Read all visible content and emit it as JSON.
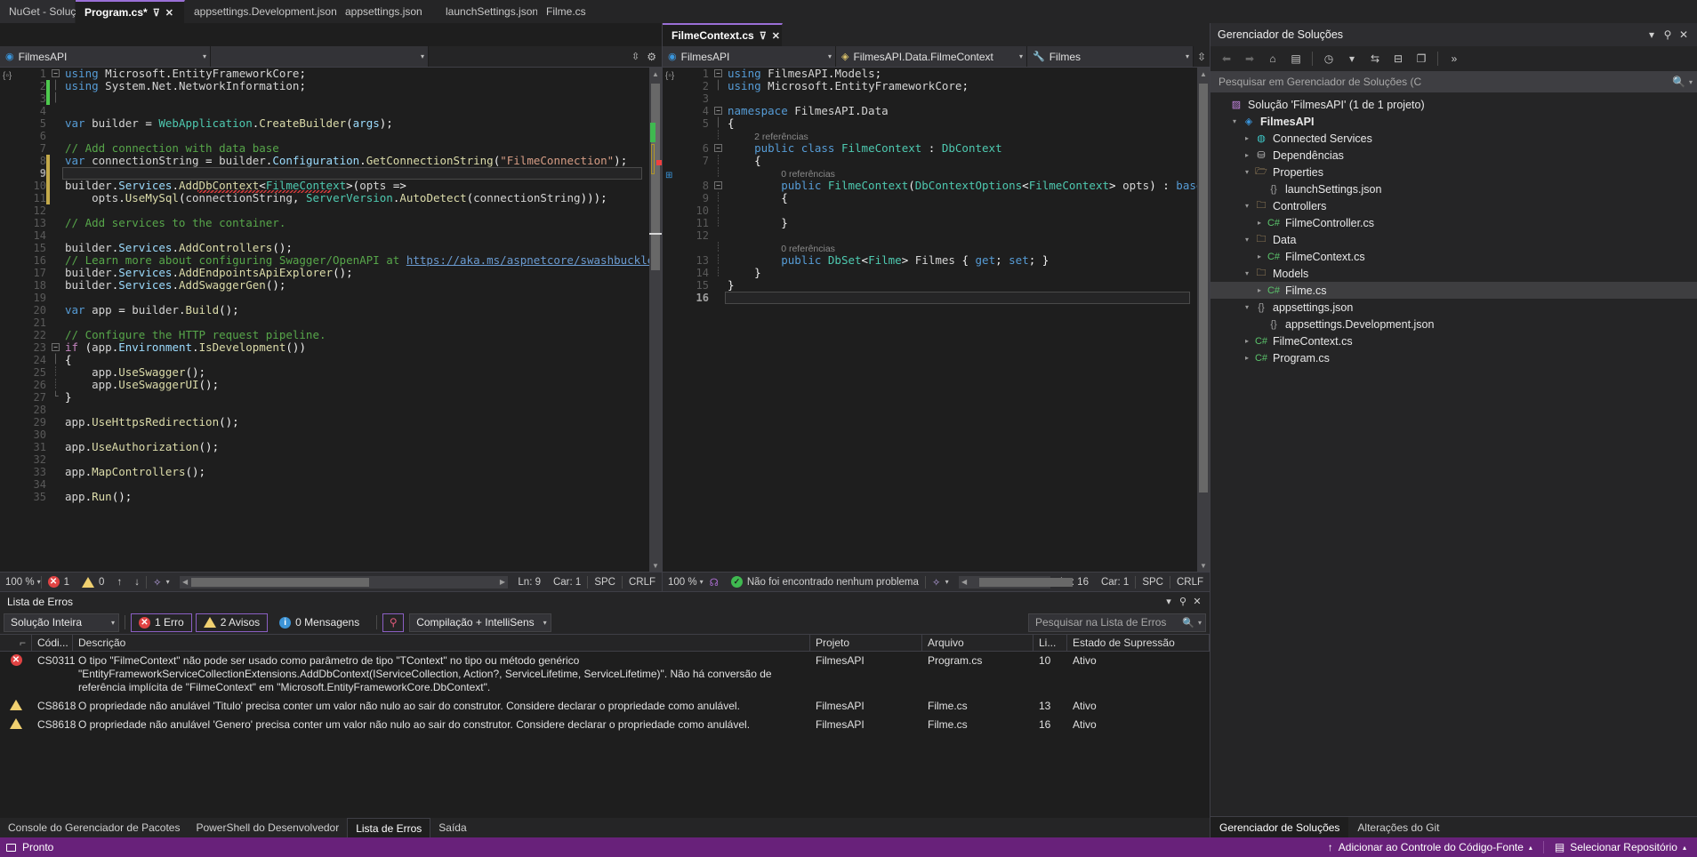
{
  "top_tabs": [
    {
      "label": "NuGet - Solução",
      "state": "inactive",
      "kind": "tool"
    },
    {
      "label": "Program.cs*",
      "state": "active",
      "kind": "doc",
      "pin": "⊽",
      "close": "✕"
    },
    {
      "label": "appsettings.Development.json",
      "state": "inactive",
      "kind": "doc"
    },
    {
      "label": "appsettings.json",
      "state": "inactive",
      "kind": "doc"
    },
    {
      "label": "launchSettings.json",
      "state": "inactive",
      "kind": "doc"
    },
    {
      "label": "Filme.cs",
      "state": "inactive",
      "kind": "doc"
    }
  ],
  "left_pane": {
    "tab": {
      "label": "Filme.cs",
      "menu_icon": "▼",
      "settings_icon": "⚙"
    },
    "nav_left": {
      "label": "FilmesAPI",
      "icon": "globe-icon",
      "caret": "▾"
    },
    "nav_right": {
      "label": "",
      "caret": "▾"
    },
    "status": {
      "zoom": "100 %",
      "error_count": "1",
      "warning_count": "0",
      "up_arrow": "↑",
      "down_arrow": "↓",
      "line": "Ln: 9",
      "col": "Car: 1",
      "spaces": "SPC",
      "eol": "CRLF"
    },
    "code": [
      {
        "n": "1",
        "fold": "minus",
        "chg": "",
        "html": "<span class=\"kw\">using</span> <span class=\"ns\">Microsoft</span>.<span class=\"ns\">EntityFrameworkCore</span>;"
      },
      {
        "n": "2",
        "fold": "bar",
        "chg": "green",
        "html": "<span class=\"kw\">using</span> <span class=\"ns\">System</span>.<span class=\"ns\">Net</span>.<span class=\"ns\">NetworkInformation</span>;"
      },
      {
        "n": "3",
        "fold": "bar",
        "chg": "green",
        "html": ""
      },
      {
        "n": "4",
        "fold": "",
        "chg": "",
        "html": ""
      },
      {
        "n": "5",
        "fold": "",
        "chg": "",
        "html": "<span class=\"kw\">var</span> <span class=\"id\">builder</span> = <span class=\"typ\">WebApplication</span>.<span class=\"fn\">CreateBuilder</span>(<span class=\"var\">args</span>);"
      },
      {
        "n": "6",
        "fold": "",
        "chg": "",
        "html": ""
      },
      {
        "n": "7",
        "fold": "",
        "chg": "",
        "html": "<span class=\"cmt\">// Add connection with data base</span>"
      },
      {
        "n": "8",
        "fold": "",
        "chg": "yellow",
        "html": "<span class=\"kw\">var</span> <span class=\"id\">connectionString</span> = <span class=\"id\">builder</span>.<span class=\"var\">Configuration</span>.<span class=\"fn\">GetConnectionString</span>(<span class=\"str\">\"FilmeConnection\"</span>);"
      },
      {
        "n": "9",
        "fold": "",
        "chg": "yellow",
        "html": "",
        "current": true,
        "pencil": true
      },
      {
        "n": "10",
        "fold": "",
        "chg": "yellow",
        "html": "<span class=\"id\">builder</span>.<span class=\"var\">Services</span>.<span class=\"fn\">AddDbContext</span>&lt;<span class=\"typ\">FilmeContext</span>&gt;(<span class=\"id\">opts</span> =&gt;",
        "error_squiggle": true
      },
      {
        "n": "11",
        "fold": "",
        "chg": "yellow",
        "html": "    <span class=\"id\">opts</span>.<span class=\"fn\">UseMySql</span>(<span class=\"id\">connectionString</span>, <span class=\"typ\">ServerVersion</span>.<span class=\"fn\">AutoDetect</span>(<span class=\"id\">connectionString</span>)));"
      },
      {
        "n": "12",
        "fold": "",
        "chg": "",
        "html": ""
      },
      {
        "n": "13",
        "fold": "",
        "chg": "",
        "html": "<span class=\"cmt\">// Add services to the container.</span>"
      },
      {
        "n": "14",
        "fold": "",
        "chg": "",
        "html": ""
      },
      {
        "n": "15",
        "fold": "",
        "chg": "",
        "html": "<span class=\"id\">builder</span>.<span class=\"var\">Services</span>.<span class=\"fn\">AddControllers</span>();"
      },
      {
        "n": "16",
        "fold": "",
        "chg": "",
        "html": "<span class=\"cmt\">// Learn more about configuring Swagger/OpenAPI at </span><span class=\"lnk\">https://aka.ms/aspnetcore/swashbuckle</span>"
      },
      {
        "n": "17",
        "fold": "",
        "chg": "",
        "html": "<span class=\"id\">builder</span>.<span class=\"var\">Services</span>.<span class=\"fn\">AddEndpointsApiExplorer</span>();"
      },
      {
        "n": "18",
        "fold": "",
        "chg": "",
        "html": "<span class=\"id\">builder</span>.<span class=\"var\">Services</span>.<span class=\"fn\">AddSwaggerGen</span>();"
      },
      {
        "n": "19",
        "fold": "",
        "chg": "",
        "html": ""
      },
      {
        "n": "20",
        "fold": "",
        "chg": "",
        "html": "<span class=\"kw\">var</span> <span class=\"id\">app</span> = <span class=\"id\">builder</span>.<span class=\"fn\">Build</span>();"
      },
      {
        "n": "21",
        "fold": "",
        "chg": "",
        "html": ""
      },
      {
        "n": "22",
        "fold": "",
        "chg": "",
        "html": "<span class=\"cmt\">// Configure the HTTP request pipeline.</span>"
      },
      {
        "n": "23",
        "fold": "minus",
        "chg": "",
        "html": "<span class=\"kwc\">if</span> (<span class=\"id\">app</span>.<span class=\"var\">Environment</span>.<span class=\"fn\">IsDevelopment</span>())"
      },
      {
        "n": "24",
        "fold": "bar",
        "chg": "",
        "html": "{"
      },
      {
        "n": "25",
        "fold": "dot",
        "chg": "",
        "html": "    <span class=\"id\">app</span>.<span class=\"fn\">UseSwagger</span>();"
      },
      {
        "n": "26",
        "fold": "dot",
        "chg": "",
        "html": "    <span class=\"id\">app</span>.<span class=\"fn\">UseSwaggerUI</span>();"
      },
      {
        "n": "27",
        "fold": "end",
        "chg": "",
        "html": "}"
      },
      {
        "n": "28",
        "fold": "",
        "chg": "",
        "html": ""
      },
      {
        "n": "29",
        "fold": "",
        "chg": "",
        "html": "<span class=\"id\">app</span>.<span class=\"fn\">UseHttpsRedirection</span>();"
      },
      {
        "n": "30",
        "fold": "",
        "chg": "",
        "html": ""
      },
      {
        "n": "31",
        "fold": "",
        "chg": "",
        "html": "<span class=\"id\">app</span>.<span class=\"fn\">UseAuthorization</span>();"
      },
      {
        "n": "32",
        "fold": "",
        "chg": "",
        "html": ""
      },
      {
        "n": "33",
        "fold": "",
        "chg": "",
        "html": "<span class=\"id\">app</span>.<span class=\"fn\">MapControllers</span>();"
      },
      {
        "n": "34",
        "fold": "",
        "chg": "",
        "html": ""
      },
      {
        "n": "35",
        "fold": "",
        "chg": "",
        "html": "<span class=\"id\">app</span>.<span class=\"fn\">Run</span>();"
      }
    ]
  },
  "right_pane": {
    "tab": {
      "label": "FilmeContext.cs",
      "pin": "⊽",
      "close": "✕"
    },
    "nav_left": {
      "label": "FilmesAPI",
      "icon": "globe-icon",
      "caret": "▾"
    },
    "nav_mid": {
      "label": "FilmesAPI.Data.FilmeContext",
      "icon": "class-icon",
      "caret": "▾"
    },
    "nav_right": {
      "label": "Filmes",
      "icon": "wrench-icon",
      "caret": "▾"
    },
    "status": {
      "zoom": "100 %",
      "message": "Não foi encontrado nenhum problema",
      "line": "Ln: 16",
      "col": "Car: 1",
      "spaces": "SPC",
      "eol": "CRLF"
    },
    "code": [
      {
        "n": "1",
        "fold": "minus",
        "html": "<span class=\"kw\">using</span> <span class=\"ns\">FilmesAPI</span>.<span class=\"ns\">Models</span>;"
      },
      {
        "n": "2",
        "fold": "bar",
        "html": "<span class=\"kw\">using</span> <span class=\"ns\">Microsoft</span>.<span class=\"ns\">EntityFrameworkCore</span>;"
      },
      {
        "n": "3",
        "fold": "",
        "html": ""
      },
      {
        "n": "4",
        "fold": "minus",
        "html": "<span class=\"kw\">namespace</span> <span class=\"ns\">FilmesAPI</span>.<span class=\"ns\">Data</span>"
      },
      {
        "n": "5",
        "fold": "bar",
        "html": "{"
      },
      {
        "n": "",
        "fold": "dot",
        "html": "    <span class=\"refs\">2 referências</span>",
        "isref": true
      },
      {
        "n": "6",
        "fold": "minus2",
        "html": "    <span class=\"kw\">public</span> <span class=\"kw\">class</span> <span class=\"typ\">FilmeContext</span> : <span class=\"typ\">DbContext</span>",
        "glyph": "io"
      },
      {
        "n": "7",
        "fold": "dot",
        "html": "    {"
      },
      {
        "n": "",
        "fold": "dot",
        "html": "        <span class=\"refs\">0 referências</span>",
        "isref": true
      },
      {
        "n": "8",
        "fold": "minus2",
        "html": "        <span class=\"kw\">public</span> <span class=\"typ\">FilmeContext</span>(<span class=\"typ\">DbContextOptions</span>&lt;<span class=\"typ\">FilmeContext</span>&gt; <span class=\"id\">opts</span>) : <span class=\"kw\">base</span>(<span class=\"id\">opts</span>)"
      },
      {
        "n": "9",
        "fold": "dot",
        "html": "        {"
      },
      {
        "n": "10",
        "fold": "dot",
        "html": ""
      },
      {
        "n": "11",
        "fold": "dot",
        "html": "        }"
      },
      {
        "n": "12",
        "fold": "",
        "html": ""
      },
      {
        "n": "",
        "fold": "dot",
        "html": "        <span class=\"refs\">0 referências</span>",
        "isref": true
      },
      {
        "n": "13",
        "fold": "dot",
        "html": "        <span class=\"kw\">public</span> <span class=\"typ\">DbSet</span>&lt;<span class=\"typ\">Filme</span>&gt; <span class=\"id\">Filmes</span> { <span class=\"kw\">get</span>; <span class=\"kw\">set</span>; }"
      },
      {
        "n": "14",
        "fold": "dot",
        "html": "    }"
      },
      {
        "n": "15",
        "fold": "",
        "html": "}"
      },
      {
        "n": "16",
        "fold": "",
        "html": "",
        "current": true
      }
    ]
  },
  "solution_explorer": {
    "title": "Gerenciador de Soluções",
    "title_icons": {
      "dropdown": "▾",
      "pin": "⚲",
      "close": "✕"
    },
    "toolbar": [
      {
        "name": "back-icon",
        "glyph": "⬅",
        "dim": true
      },
      {
        "name": "forward-icon",
        "glyph": "➡",
        "dim": true
      },
      {
        "name": "home-icon",
        "glyph": "⌂",
        "dim": false
      },
      {
        "name": "pending-changes-icon",
        "glyph": "▤",
        "dim": false
      },
      {
        "name": "history-icon",
        "glyph": "◷",
        "dim": false
      },
      {
        "name": "history-dropdown-icon",
        "glyph": "▾",
        "dim": false
      },
      {
        "name": "sync-icon",
        "glyph": "⇆",
        "dim": false
      },
      {
        "name": "collapse-all-icon",
        "glyph": "⊟",
        "dim": false
      },
      {
        "name": "properties-icon",
        "glyph": "❐",
        "dim": false
      },
      {
        "name": "overflow-icon",
        "glyph": "»",
        "dim": false
      }
    ],
    "search_placeholder": "Pesquisar em Gerenciador de Soluções (C",
    "search_icon": "🔍",
    "search_caret": "▾",
    "tree": [
      {
        "indent": 0,
        "exp": "",
        "icon": "solution-icon",
        "iconglyph": "▨",
        "color": "#c586e0",
        "label": "Solução 'FilmesAPI' (1 de 1 projeto)",
        "bold": false,
        "sel": false
      },
      {
        "indent": 1,
        "exp": "▾",
        "icon": "project-icon",
        "iconglyph": "◈",
        "color": "#3a96dd",
        "label": "FilmesAPI",
        "bold": true,
        "sel": false
      },
      {
        "indent": 2,
        "exp": "▸",
        "icon": "connected-services-icon",
        "iconglyph": "◍",
        "color": "#3ec9c9",
        "label": "Connected Services",
        "bold": false,
        "sel": false
      },
      {
        "indent": 2,
        "exp": "▸",
        "icon": "dependencies-icon",
        "iconglyph": "⛁",
        "color": "#c8c8c8",
        "label": "Dependências",
        "bold": false,
        "sel": false
      },
      {
        "indent": 2,
        "exp": "▾",
        "icon": "properties-folder-icon",
        "iconglyph": "🗁",
        "color": "#dcb67a",
        "label": "Properties",
        "bold": false,
        "sel": false
      },
      {
        "indent": 3,
        "exp": "",
        "icon": "json-file-icon",
        "iconglyph": "{}",
        "color": "#a0a0a0",
        "label": "launchSettings.json",
        "bold": false,
        "sel": false
      },
      {
        "indent": 2,
        "exp": "▾",
        "icon": "folder-icon",
        "iconglyph": "🗀",
        "color": "#dcb67a",
        "label": "Controllers",
        "bold": false,
        "sel": false
      },
      {
        "indent": 3,
        "exp": "▸",
        "icon": "csharp-file-icon",
        "iconglyph": "C#",
        "color": "#5bc46b",
        "label": "FilmeController.cs",
        "bold": false,
        "sel": false
      },
      {
        "indent": 2,
        "exp": "▾",
        "icon": "folder-icon",
        "iconglyph": "🗀",
        "color": "#dcb67a",
        "label": "Data",
        "bold": false,
        "sel": false
      },
      {
        "indent": 3,
        "exp": "▸",
        "icon": "csharp-file-icon",
        "iconglyph": "C#",
        "color": "#5bc46b",
        "label": "FilmeContext.cs",
        "bold": false,
        "sel": false
      },
      {
        "indent": 2,
        "exp": "▾",
        "icon": "folder-icon",
        "iconglyph": "🗀",
        "color": "#dcb67a",
        "label": "Models",
        "bold": false,
        "sel": false
      },
      {
        "indent": 3,
        "exp": "▸",
        "icon": "csharp-file-icon",
        "iconglyph": "C#",
        "color": "#5bc46b",
        "label": "Filme.cs",
        "bold": false,
        "sel": true
      },
      {
        "indent": 2,
        "exp": "▾",
        "icon": "json-file-icon",
        "iconglyph": "{}",
        "color": "#a0a0a0",
        "label": "appsettings.json",
        "bold": false,
        "sel": false
      },
      {
        "indent": 3,
        "exp": "",
        "icon": "json-file-icon",
        "iconglyph": "{}",
        "color": "#a0a0a0",
        "label": "appsettings.Development.json",
        "bold": false,
        "sel": false
      },
      {
        "indent": 2,
        "exp": "▸",
        "icon": "csharp-file-icon",
        "iconglyph": "C#",
        "color": "#5bc46b",
        "label": "FilmeContext.cs",
        "bold": false,
        "sel": false
      },
      {
        "indent": 2,
        "exp": "▸",
        "icon": "csharp-file-icon",
        "iconglyph": "C#",
        "color": "#5bc46b",
        "label": "Program.cs",
        "bold": false,
        "sel": false
      }
    ],
    "bottom_tabs": [
      {
        "label": "Gerenciador de Soluções",
        "active": true
      },
      {
        "label": "Alterações do Git",
        "active": false
      }
    ]
  },
  "error_list": {
    "title": "Lista de Erros",
    "title_icons": {
      "dropdown": "▾",
      "pin": "⚲",
      "close": "✕"
    },
    "scope_selector": "Solução Inteira",
    "scope_caret": "▾",
    "counters": [
      {
        "name": "errors",
        "label": "1 Erro",
        "icon": "error-icon"
      },
      {
        "name": "warnings",
        "label": "2 Avisos",
        "icon": "warning-icon"
      },
      {
        "name": "messages",
        "label": "0 Mensagens",
        "icon": "info-icon"
      }
    ],
    "filter_icon": "⚲",
    "build_filter": "Compilação + IntelliSens",
    "build_filter_caret": "▾",
    "search_placeholder": "Pesquisar na Lista de Erros",
    "search_icon": "🔍",
    "search_caret": "▾",
    "columns": [
      "",
      "Códi...",
      "Descrição",
      "Projeto",
      "Arquivo",
      "Li...",
      "Estado de Supressão"
    ],
    "rows": [
      {
        "severity": "error",
        "code": "CS0311",
        "description": "O tipo \"FilmeContext\" não pode ser usado como parâmetro de tipo \"TContext\" no tipo ou método genérico \"EntityFrameworkServiceCollectionExtensions.AddDbContext<TContext>(IServiceCollection, Action<DbContextOptionsBuilder>?, ServiceLifetime, ServiceLifetime)\". Não há conversão de referência implícita de \"FilmeContext\" em \"Microsoft.EntityFrameworkCore.DbContext\".",
        "project": "FilmesAPI",
        "file": "Program.cs",
        "line": "10",
        "suppression": "Ativo"
      },
      {
        "severity": "warning",
        "code": "CS8618",
        "description": "O propriedade não anulável 'Titulo' precisa conter um valor não nulo ao sair do construtor. Considere declarar o propriedade como anulável.",
        "project": "FilmesAPI",
        "file": "Filme.cs",
        "line": "13",
        "suppression": "Ativo"
      },
      {
        "severity": "warning",
        "code": "CS8618",
        "description": "O propriedade não anulável 'Genero' precisa conter um valor não nulo ao sair do construtor. Considere declarar o propriedade como anulável.",
        "project": "FilmesAPI",
        "file": "Filme.cs",
        "line": "16",
        "suppression": "Ativo"
      }
    ]
  },
  "bottom_tool_tabs": [
    {
      "label": "Console do Gerenciador de Pacotes",
      "active": false
    },
    {
      "label": "PowerShell do Desenvolvedor",
      "active": false
    },
    {
      "label": "Lista de Erros",
      "active": true
    },
    {
      "label": "Saída",
      "active": false
    }
  ],
  "status_bar": {
    "ready": "Pronto",
    "ready_icon": "window-icon",
    "source_control": "Adicionar ao Controle do Código-Fonte",
    "source_control_icon": "↑",
    "source_control_caret": "▴",
    "repository": "Selecionar Repositório",
    "repository_icon": "▤",
    "repository_caret": "▴"
  }
}
